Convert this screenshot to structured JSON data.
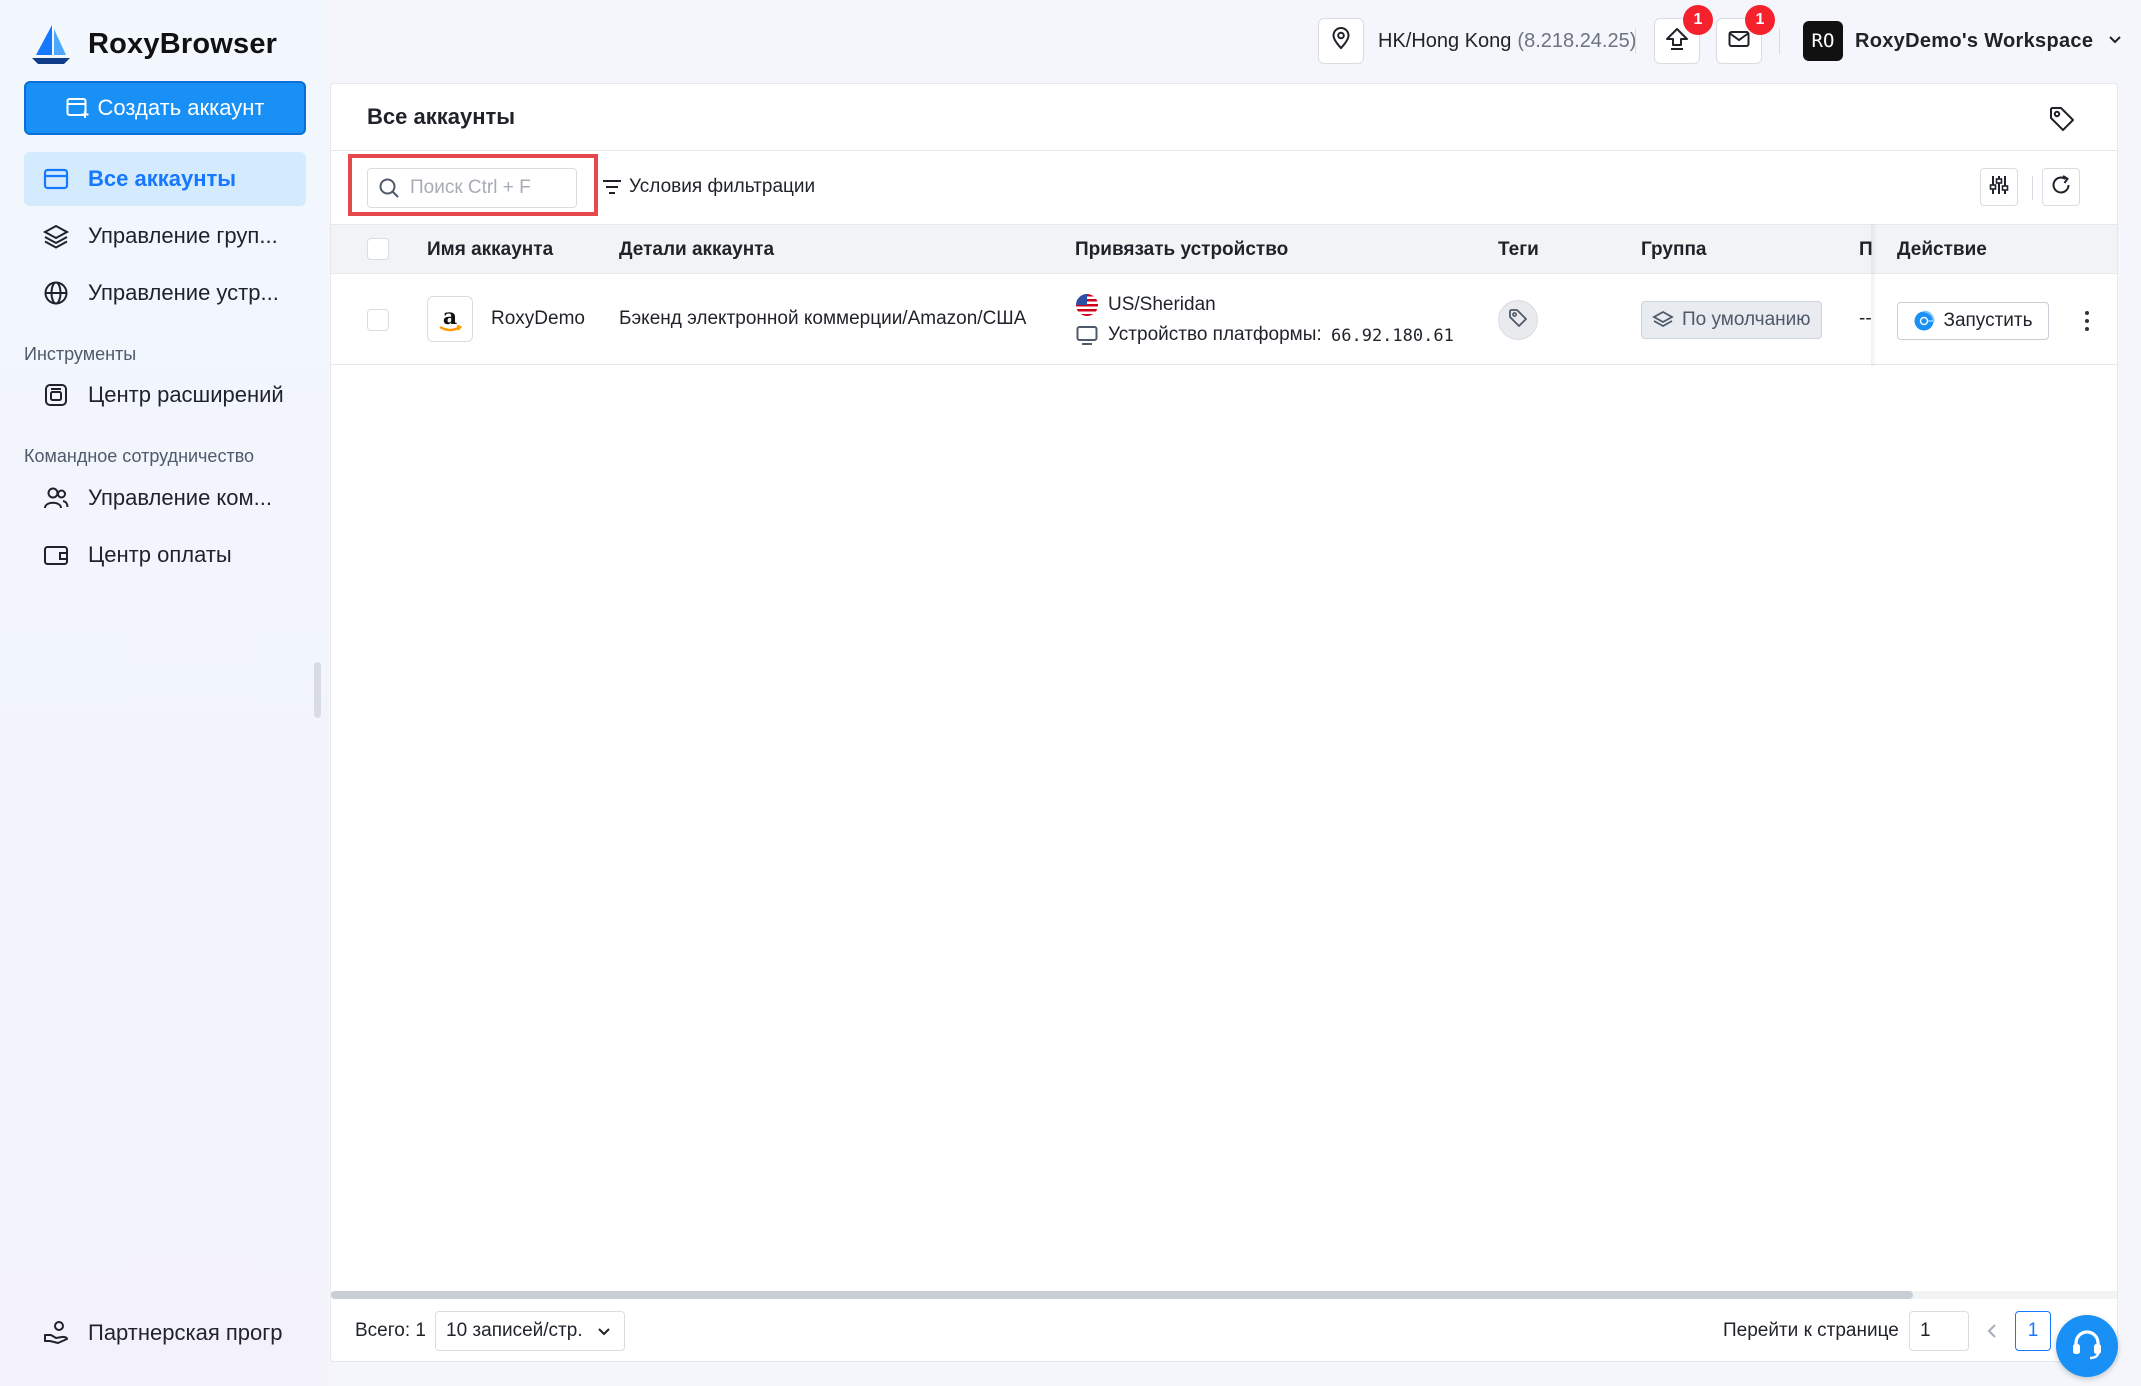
{
  "app": {
    "name": "RoxyBrowser"
  },
  "sidebar": {
    "create_button": "Создать аккаунт",
    "items": [
      {
        "label": "Все аккаунты",
        "icon": "window-icon",
        "active": true
      },
      {
        "label": "Управление груп...",
        "icon": "layers-icon"
      },
      {
        "label": "Управление устр...",
        "icon": "globe-icon"
      }
    ],
    "tools_section": "Инструменты",
    "tools_items": [
      {
        "label": "Центр расширений",
        "icon": "extension-icon"
      }
    ],
    "team_section": "Командное сотрудничество",
    "team_items": [
      {
        "label": "Управление ком...",
        "icon": "users-icon"
      },
      {
        "label": "Центр оплаты",
        "icon": "wallet-icon"
      }
    ],
    "partner": {
      "label": "Партнерская прогр",
      "icon": "handshake-icon"
    }
  },
  "topbar": {
    "location": "HK/Hong Kong",
    "ip": "(8.218.24.25)",
    "upload_badge": "1",
    "mail_badge": "1",
    "avatar": "RO",
    "workspace": "RoxyDemo's Workspace"
  },
  "main": {
    "title": "Все аккаунты",
    "search_placeholder": "Поиск Ctrl + F",
    "filter_label": "Условия фильтрации",
    "columns": {
      "name": "Имя аккаунта",
      "details": "Детали аккаунта",
      "device": "Привязать устройство",
      "tags": "Теги",
      "group": "Группа",
      "p": "П",
      "action": "Действие"
    },
    "rows": [
      {
        "name": "RoxyDemo",
        "details": "Бэкенд электронной коммерции/Amazon/США",
        "location": "US/Sheridan",
        "platform_label": "Устройство платформы:",
        "platform_ip": "66.92.180.61",
        "group": "По умолчанию",
        "p": "--",
        "action": "Запустить"
      }
    ],
    "footer": {
      "total": "Всего: 1",
      "page_size": "10 записей/стр.",
      "goto_label": "Перейти к странице",
      "goto_value": "1",
      "current_page": "1"
    }
  },
  "colors": {
    "accent": "#1890f6",
    "highlight": "#e5484d",
    "badge": "#f5222d"
  }
}
